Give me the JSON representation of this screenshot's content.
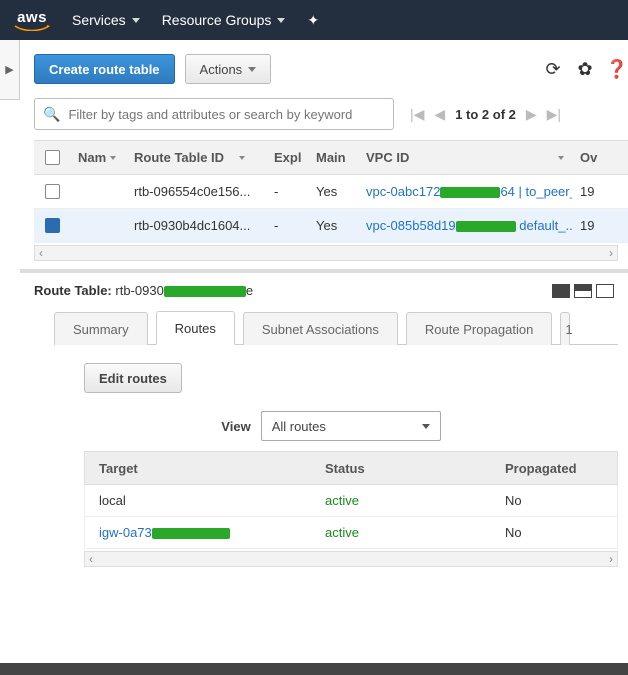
{
  "nav": {
    "logo": "aws",
    "services": "Services",
    "resource_groups": "Resource Groups"
  },
  "toolbar": {
    "create_btn": "Create route table",
    "actions_btn": "Actions"
  },
  "search": {
    "placeholder": "Filter by tags and attributes or search by keyword"
  },
  "pager": {
    "text": "1 to 2 of 2"
  },
  "columns": {
    "name": "Nam",
    "rtid": "Route Table ID",
    "expl": "Expl",
    "main": "Main",
    "vpc": "VPC ID",
    "owner": "Ov"
  },
  "rows": [
    {
      "rtid": "rtb-096554c0e156...",
      "expl": "-",
      "main": "Yes",
      "vpc_a": "vpc-0abc172",
      "vpc_b": "64 | to_peer_",
      "owner": "19",
      "selected": false
    },
    {
      "rtid": "rtb-0930b4dc1604...",
      "expl": "-",
      "main": "Yes",
      "vpc_a": "vpc-085b58d19",
      "vpc_b": " default_...",
      "owner": "19",
      "selected": true
    }
  ],
  "detail": {
    "label": "Route Table:",
    "value_a": "rtb-0930",
    "value_b": "e"
  },
  "tabs": {
    "summary": "Summary",
    "routes": "Routes",
    "subnet": "Subnet Associations",
    "propagation": "Route Propagation"
  },
  "routes_pane": {
    "edit_btn": "Edit routes",
    "view_label": "View",
    "view_value": "All routes",
    "columns": {
      "target": "Target",
      "status": "Status",
      "prop": "Propagated"
    },
    "rows": [
      {
        "target": "local",
        "target_link": false,
        "status": "active",
        "prop": "No"
      },
      {
        "target": "igw-0a73",
        "target_link": true,
        "status": "active",
        "prop": "No"
      }
    ]
  }
}
